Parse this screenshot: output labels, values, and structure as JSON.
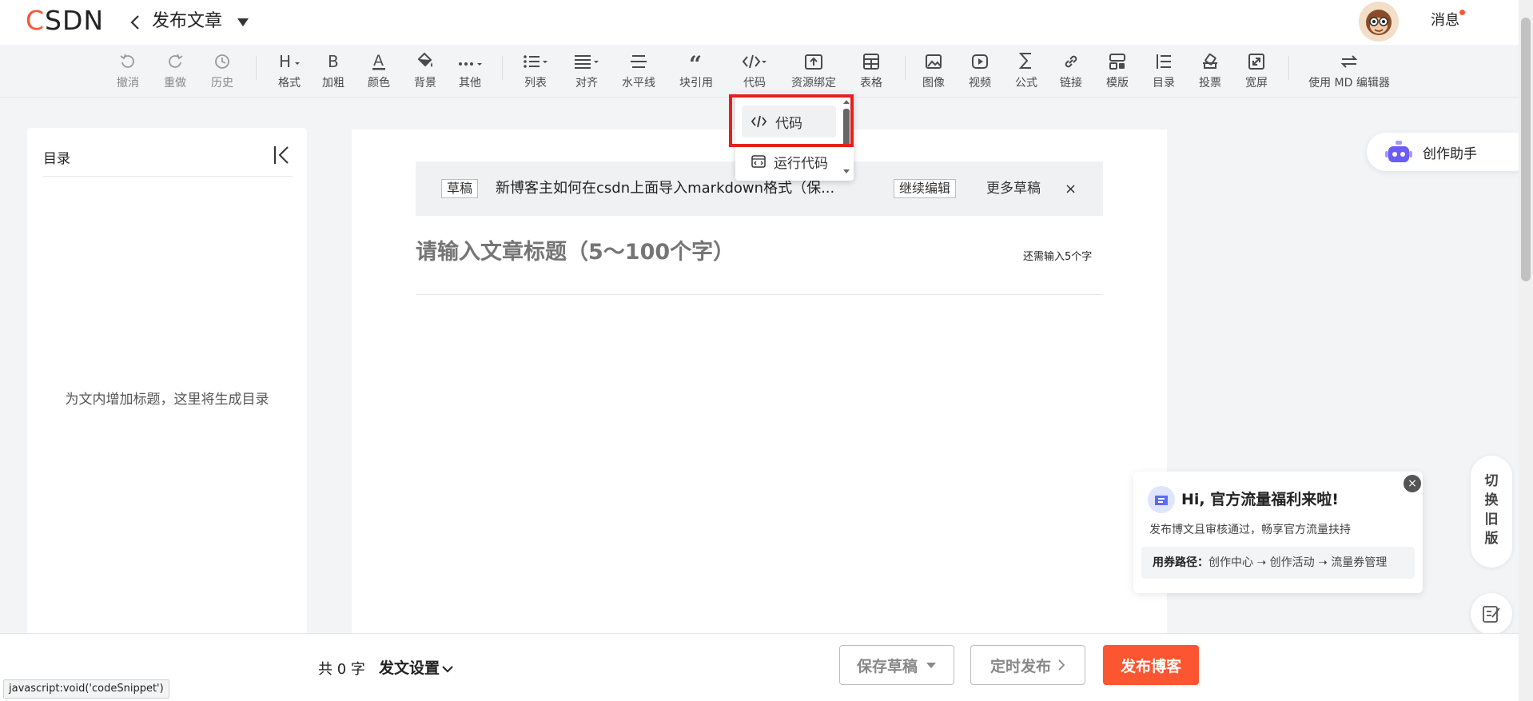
{
  "header": {
    "logo": {
      "c": "C",
      "rest": "SDN"
    },
    "title": "发布文章",
    "messages_label": "消息"
  },
  "toolbar": {
    "items": [
      {
        "label": "撤消",
        "icon": "undo-icon"
      },
      {
        "label": "重做",
        "icon": "redo-icon"
      },
      {
        "label": "历史",
        "icon": "history-icon"
      },
      {
        "label": "格式",
        "icon": "heading-icon"
      },
      {
        "label": "加粗",
        "icon": "bold-icon"
      },
      {
        "label": "颜色",
        "icon": "font-color-icon"
      },
      {
        "label": "背景",
        "icon": "background-icon"
      },
      {
        "label": "其他",
        "icon": "more-icon"
      },
      {
        "label": "列表",
        "icon": "list-icon"
      },
      {
        "label": "对齐",
        "icon": "align-icon"
      },
      {
        "label": "水平线",
        "icon": "horizontal-rule-icon"
      },
      {
        "label": "块引用",
        "icon": "quote-icon"
      },
      {
        "label": "代码",
        "icon": "code-icon"
      },
      {
        "label": "资源绑定",
        "icon": "upload-icon"
      },
      {
        "label": "表格",
        "icon": "table-icon"
      },
      {
        "label": "图像",
        "icon": "image-icon"
      },
      {
        "label": "视频",
        "icon": "video-icon"
      },
      {
        "label": "公式",
        "icon": "formula-icon"
      },
      {
        "label": "链接",
        "icon": "link-icon"
      },
      {
        "label": "模版",
        "icon": "template-icon"
      },
      {
        "label": "目录",
        "icon": "toc-icon"
      },
      {
        "label": "投票",
        "icon": "vote-icon"
      },
      {
        "label": "宽屏",
        "icon": "widescreen-icon"
      },
      {
        "label": "使用 MD 编辑器",
        "icon": "switch-editor-icon"
      }
    ]
  },
  "code_dropdown": {
    "items": [
      "代码",
      "运行代码"
    ]
  },
  "toc": {
    "title": "目录",
    "empty_text": "为文内增加标题，这里将生成目录"
  },
  "editor": {
    "draft_tag": "草稿",
    "draft_title": "新博客主如何在csdn上面导入markdown格式（保...",
    "continue_label": "继续编辑",
    "more_drafts_label": "更多草稿",
    "close_label": "×",
    "title_placeholder": "请输入文章标题（5～100个字）",
    "title_counter": "还需输入5个字"
  },
  "assistant": {
    "label": "创作助手"
  },
  "switch_old": {
    "chars": [
      "切",
      "换",
      "旧",
      "版"
    ]
  },
  "promo": {
    "title": "Hi, 官方流量福利来啦!",
    "subtitle": "发布博文且审核通过，畅享官方流量扶持",
    "path_label": "用券路径：",
    "path": "创作中心 ➝ 创作活动 ➝ 流量券管理",
    "close": "×"
  },
  "bottom": {
    "word_count": "共 0 字",
    "settings_label": "发文设置",
    "save_draft": "保存草稿",
    "schedule": "定时发布",
    "publish": "发布博客"
  },
  "status_url": "javascript:void('codeSnippet')",
  "colors": {
    "brand": "#fc5531",
    "highlight": "#e5201c"
  }
}
